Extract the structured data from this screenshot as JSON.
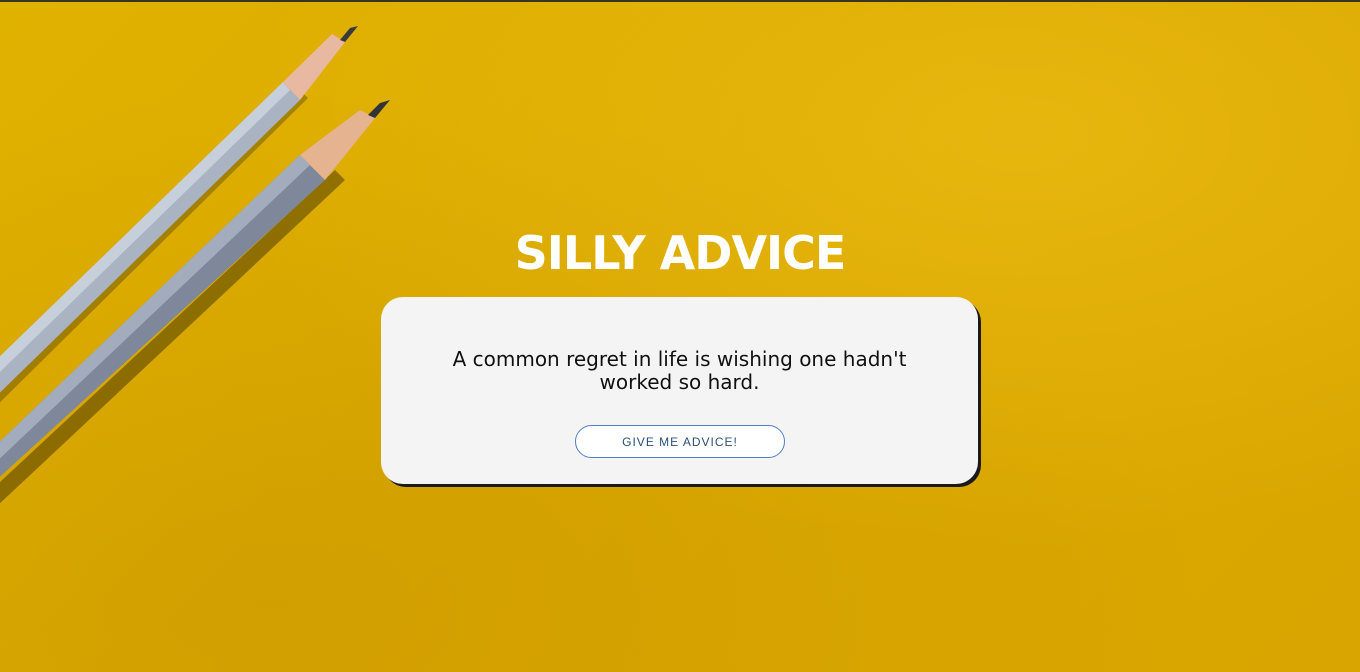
{
  "page": {
    "title": "SILLY ADVICE"
  },
  "card": {
    "advice_text": "A common regret in life is wishing one hadn't worked so hard.",
    "button_label": "GIVE ME ADVICE!"
  },
  "colors": {
    "background": "#e2b000",
    "card": "#f4f4f4",
    "title": "#ffffff",
    "button_border": "#4f7fc2",
    "button_text": "#2b4f7a"
  }
}
